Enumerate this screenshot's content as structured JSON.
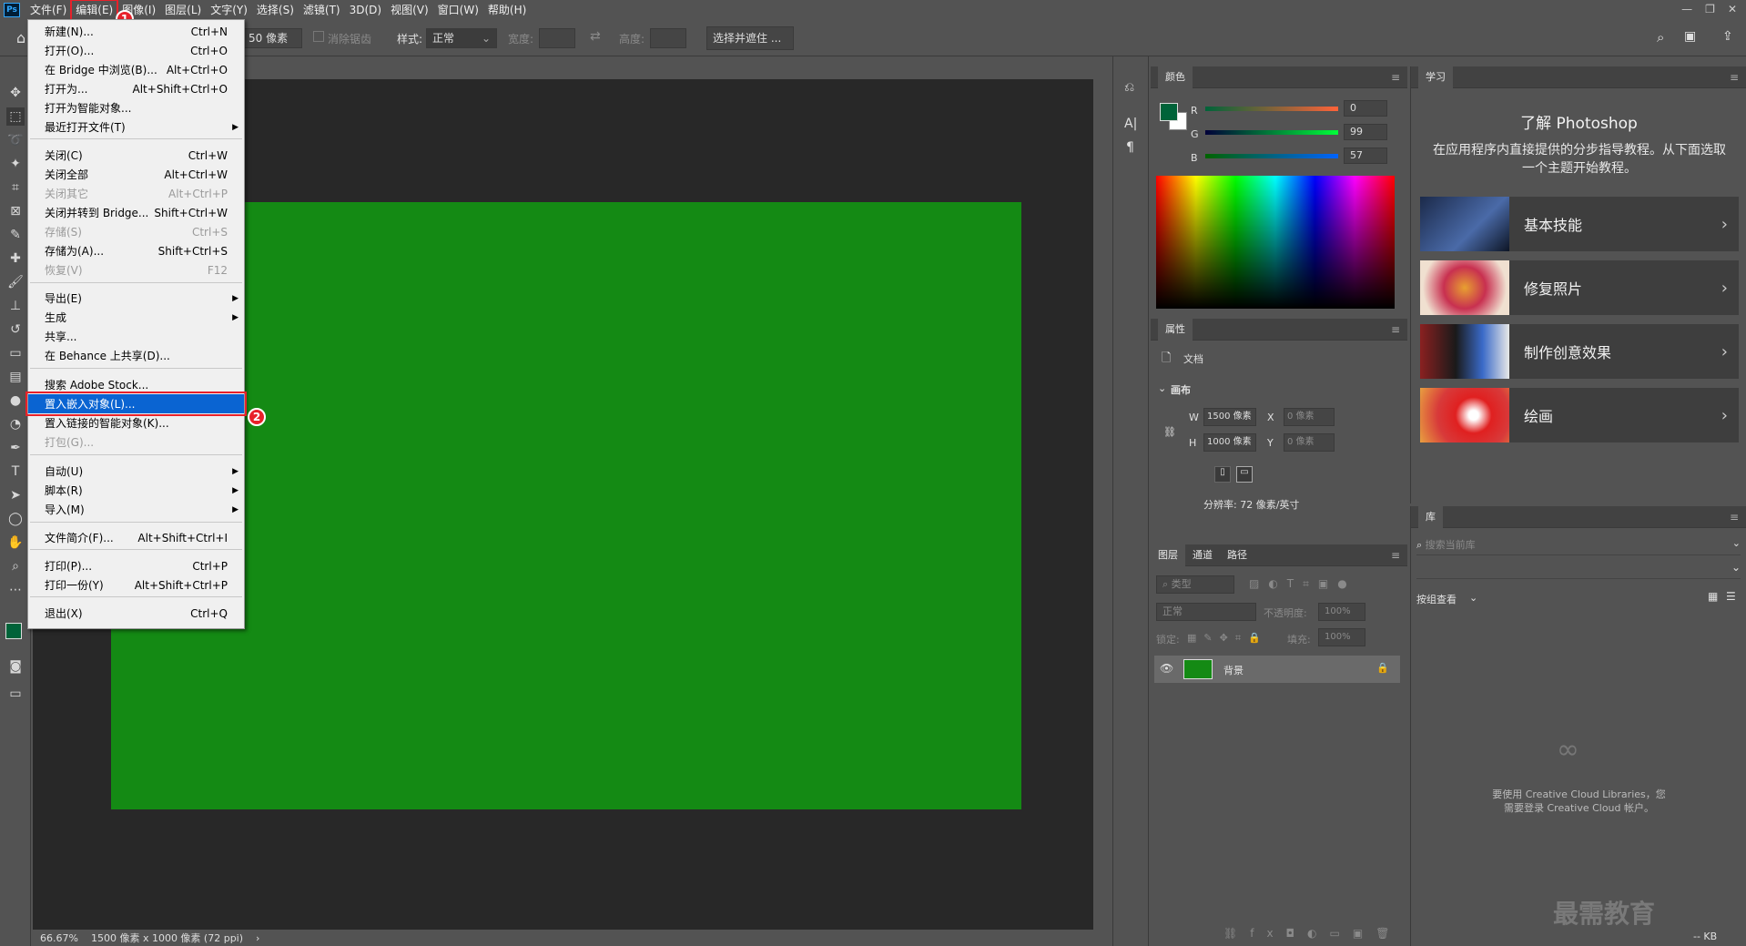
{
  "menubar": {
    "items": [
      "文件(F)",
      "编辑(E)",
      "图像(I)",
      "图层(L)",
      "文字(Y)",
      "选择(S)",
      "滤镜(T)",
      "3D(D)",
      "视图(V)",
      "窗口(W)",
      "帮助(H)"
    ],
    "logo": "Ps"
  },
  "annotations": {
    "badge1": "1",
    "badge2": "2"
  },
  "options": {
    "feather_value": "50 像素",
    "antialias_label": "消除锯齿",
    "style_label": "样式:",
    "style_value": "正常",
    "width_label": "宽度:",
    "height_label": "高度:",
    "select_mask_button": "选择并遮住 ..."
  },
  "file_menu": {
    "items": [
      {
        "label": "新建(N)...",
        "shortcut": "Ctrl+N",
        "enabled": true
      },
      {
        "label": "打开(O)...",
        "shortcut": "Ctrl+O",
        "enabled": true
      },
      {
        "label": "在 Bridge 中浏览(B)...",
        "shortcut": "Alt+Ctrl+O",
        "enabled": true
      },
      {
        "label": "打开为...",
        "shortcut": "Alt+Shift+Ctrl+O",
        "enabled": true
      },
      {
        "label": "打开为智能对象...",
        "shortcut": "",
        "enabled": true
      },
      {
        "label": "最近打开文件(T)",
        "shortcut": "",
        "enabled": true,
        "submenu": true
      },
      {
        "label": "关闭(C)",
        "shortcut": "Ctrl+W",
        "enabled": true
      },
      {
        "label": "关闭全部",
        "shortcut": "Alt+Ctrl+W",
        "enabled": true
      },
      {
        "label": "关闭其它",
        "shortcut": "Alt+Ctrl+P",
        "enabled": false
      },
      {
        "label": "关闭并转到 Bridge...",
        "shortcut": "Shift+Ctrl+W",
        "enabled": true
      },
      {
        "label": "存储(S)",
        "shortcut": "Ctrl+S",
        "enabled": false
      },
      {
        "label": "存储为(A)...",
        "shortcut": "Shift+Ctrl+S",
        "enabled": true
      },
      {
        "label": "恢复(V)",
        "shortcut": "F12",
        "enabled": false
      },
      {
        "label": "导出(E)",
        "shortcut": "",
        "enabled": true,
        "submenu": true
      },
      {
        "label": "生成",
        "shortcut": "",
        "enabled": true,
        "submenu": true
      },
      {
        "label": "共享...",
        "shortcut": "",
        "enabled": true
      },
      {
        "label": "在 Behance 上共享(D)...",
        "shortcut": "",
        "enabled": true
      },
      {
        "label": "搜索 Adobe Stock...",
        "shortcut": "",
        "enabled": true
      },
      {
        "label": "置入嵌入对象(L)...",
        "shortcut": "",
        "enabled": true,
        "selected": true
      },
      {
        "label": "置入链接的智能对象(K)...",
        "shortcut": "",
        "enabled": true
      },
      {
        "label": "打包(G)...",
        "shortcut": "",
        "enabled": false
      },
      {
        "label": "自动(U)",
        "shortcut": "",
        "enabled": true,
        "submenu": true
      },
      {
        "label": "脚本(R)",
        "shortcut": "",
        "enabled": true,
        "submenu": true
      },
      {
        "label": "导入(M)",
        "shortcut": "",
        "enabled": true,
        "submenu": true
      },
      {
        "label": "文件简介(F)...",
        "shortcut": "Alt+Shift+Ctrl+I",
        "enabled": true
      },
      {
        "label": "打印(P)...",
        "shortcut": "Ctrl+P",
        "enabled": true
      },
      {
        "label": "打印一份(Y)",
        "shortcut": "Alt+Shift+Ctrl+P",
        "enabled": true
      },
      {
        "label": "退出(X)",
        "shortcut": "Ctrl+Q",
        "enabled": true
      }
    ]
  },
  "status": {
    "zoom": "66.67%",
    "doc_info": "1500 像素 x 1000 像素 (72 ppi)"
  },
  "color_panel": {
    "title": "颜色",
    "r_label": "R",
    "r_value": "0",
    "g_label": "G",
    "g_value": "99",
    "b_label": "B",
    "b_value": "57",
    "foreground": "#006339"
  },
  "properties_panel": {
    "title": "属性",
    "doc_label": "文档",
    "canvas_label": "画布",
    "w_label": "W",
    "w_value": "1500 像素",
    "h_label": "H",
    "h_value": "1000 像素",
    "x_label": "X",
    "x_placeholder": "0 像素",
    "y_label": "Y",
    "y_placeholder": "0 像素",
    "resolution": "分辨率: 72 像素/英寸"
  },
  "layers_panel": {
    "tabs": [
      "图层",
      "通道",
      "路径"
    ],
    "filter_placeholder": "类型",
    "blend_mode": "正常",
    "opacity_label": "不透明度:",
    "opacity_value": "100%",
    "lock_label": "锁定:",
    "fill_label": "填充:",
    "fill_value": "100%",
    "layer_name": "背景"
  },
  "learn_panel": {
    "tab": "学习",
    "heading": "了解 Photoshop",
    "desc": "在应用程序内直接提供的分步指导教程。从下面选取一个主题开始教程。",
    "cards": [
      "基本技能",
      "修复照片",
      "制作创意效果",
      "绘画"
    ]
  },
  "library_panel": {
    "tab": "库",
    "search_placeholder": "搜索当前库",
    "group_label": "按组查看",
    "cc_message_1": "要使用 Creative Cloud Libraries，您",
    "cc_message_2": "需要登录 Creative Cloud 帐户。",
    "size_label": "-- KB"
  },
  "watermark": "最需教育",
  "colors": {
    "canvas_green": "#148a14",
    "highlight_red": "#e8212a",
    "menu_select": "#0a64d2"
  }
}
